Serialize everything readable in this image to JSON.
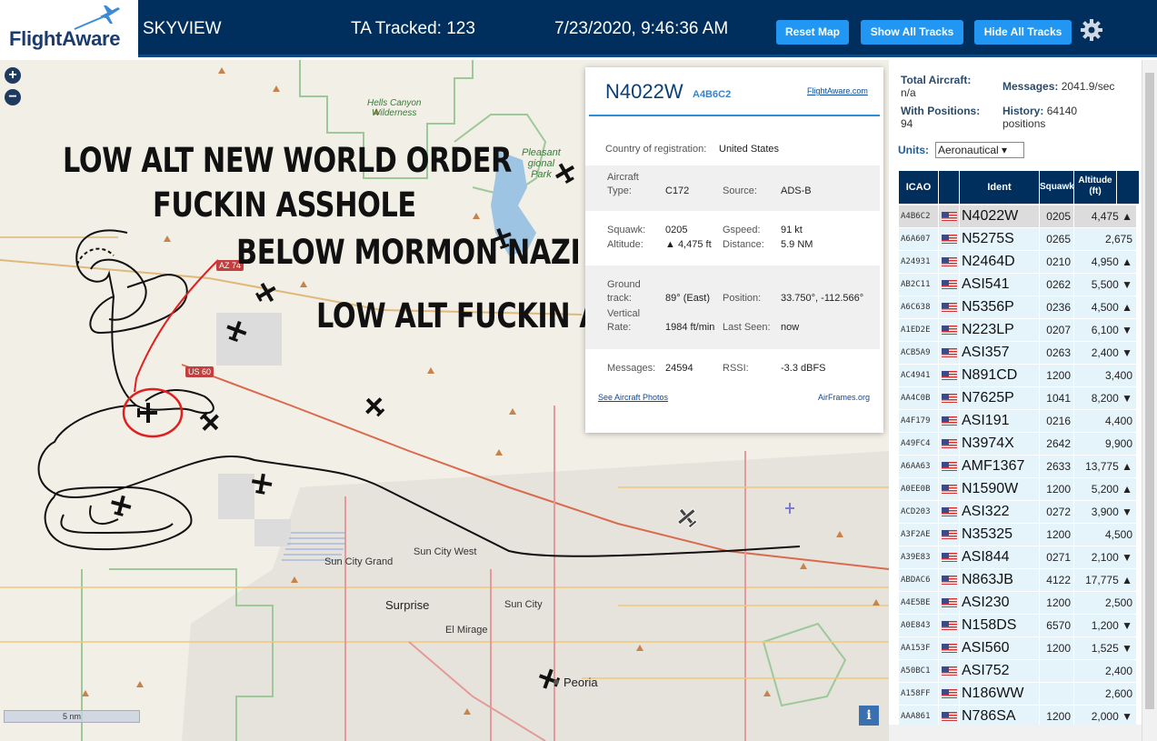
{
  "header": {
    "logo_text": "FlightAware",
    "app_name": "SKYVIEW",
    "tracked": "TA Tracked: 123",
    "clock": "7/23/2020, 9:46:36 AM",
    "buttons": {
      "reset": "Reset Map",
      "show": "Show All Tracks",
      "hide": "Hide All Tracks"
    }
  },
  "map": {
    "zoom_in": "+",
    "zoom_out": "−",
    "scale": "5 nm",
    "info": "i",
    "labels": {
      "hells_canyon": "Hells Canyon\nWilderness",
      "lake_pleasant": "Pleasant\ngional\nPark",
      "sun_city_grand": "Sun City Grand",
      "sun_city_west": "Sun City West",
      "surprise": "Surprise",
      "sun_city": "Sun City",
      "el_mirage": "El Mirage",
      "peoria": "Peoria"
    },
    "roads": [
      "AZ 74",
      "US 60"
    ],
    "overlay_text": [
      "LOW ALT NEW WORLD ORDER",
      "FUCKIN ASSHOLE",
      "BELOW MORMON NAZI VFR",
      "LOW ALT FUCKIN ASSHOLE"
    ]
  },
  "popup": {
    "ident": "N4022W",
    "hex": "A4B6C2",
    "fa_link": "FlightAware.com",
    "country_label": "Country of registration:",
    "country": "United States",
    "aircraft_type_label": "Aircraft\nType:",
    "aircraft_type": "C172",
    "source_label": "Source:",
    "source": "ADS-B",
    "squawk_label": "Squawk:",
    "squawk": "0205",
    "altitude_label": "Altitude:",
    "altitude": "▲ 4,475 ft",
    "gspeed_label": "Gspeed:",
    "gspeed": "91 kt",
    "distance_label": "Distance:",
    "distance": "5.9 NM",
    "track_label": "Ground\ntrack:",
    "track": "89° (East)",
    "position_label": "Position:",
    "position": "33.750°, -112.566°",
    "rate_label": "Vertical\nRate:",
    "rate": "1984 ft/min",
    "lastseen_label": "Last Seen:",
    "lastseen": "now",
    "messages_label": "Messages:",
    "messages": "24594",
    "rssi_label": "RSSI:",
    "rssi": "-3.3 dBFS",
    "photos_link": "See Aircraft Photos",
    "airframes_link": "AirFrames.org"
  },
  "panel": {
    "total_label": "Total Aircraft:",
    "total": "n/a",
    "messages_label": "Messages:",
    "messages": "2041.9/sec",
    "positions_label": "With Positions:",
    "positions": "94",
    "history_label": "History:",
    "history": "64140 positions",
    "units_label": "Units:",
    "units_value": "Aeronautical ▾",
    "columns": {
      "icao": "ICAO",
      "ident": "Ident",
      "squawk": "Squawk",
      "altitude": "Altitude\n(ft)"
    },
    "rows": [
      {
        "icao": "A4B6C2",
        "ident": "N4022W",
        "squawk": "0205",
        "alt": "4,475 ▲"
      },
      {
        "icao": "A6A607",
        "ident": "N5275S",
        "squawk": "0265",
        "alt": "2,675"
      },
      {
        "icao": "A24931",
        "ident": "N2464D",
        "squawk": "0210",
        "alt": "4,950 ▲"
      },
      {
        "icao": "AB2C11",
        "ident": "ASI541",
        "squawk": "0262",
        "alt": "5,500 ▼"
      },
      {
        "icao": "A6C638",
        "ident": "N5356P",
        "squawk": "0236",
        "alt": "4,500 ▲"
      },
      {
        "icao": "A1ED2E",
        "ident": "N223LP",
        "squawk": "0207",
        "alt": "6,100 ▼"
      },
      {
        "icao": "ACB5A9",
        "ident": "ASI357",
        "squawk": "0263",
        "alt": "2,400 ▼"
      },
      {
        "icao": "AC4941",
        "ident": "N891CD",
        "squawk": "1200",
        "alt": "3,400"
      },
      {
        "icao": "AA4C0B",
        "ident": "N7625P",
        "squawk": "1041",
        "alt": "8,200 ▼"
      },
      {
        "icao": "A4F179",
        "ident": "ASI191",
        "squawk": "0216",
        "alt": "4,400"
      },
      {
        "icao": "A49FC4",
        "ident": "N3974X",
        "squawk": "2642",
        "alt": "9,900"
      },
      {
        "icao": "A6AA63",
        "ident": "AMF1367",
        "squawk": "2633",
        "alt": "13,775 ▲"
      },
      {
        "icao": "A0EE0B",
        "ident": "N1590W",
        "squawk": "1200",
        "alt": "5,200 ▲"
      },
      {
        "icao": "ACD203",
        "ident": "ASI322",
        "squawk": "0272",
        "alt": "3,900 ▼"
      },
      {
        "icao": "A3F2AE",
        "ident": "N35325",
        "squawk": "1200",
        "alt": "4,500"
      },
      {
        "icao": "A39E83",
        "ident": "ASI844",
        "squawk": "0271",
        "alt": "2,100 ▼"
      },
      {
        "icao": "ABDAC6",
        "ident": "N863JB",
        "squawk": "4122",
        "alt": "17,775 ▲"
      },
      {
        "icao": "A4E5BE",
        "ident": "ASI230",
        "squawk": "1200",
        "alt": "2,500"
      },
      {
        "icao": "A0E843",
        "ident": "N158DS",
        "squawk": "6570",
        "alt": "1,200 ▼"
      },
      {
        "icao": "AA153F",
        "ident": "ASI560",
        "squawk": "1200",
        "alt": "1,525 ▼"
      },
      {
        "icao": "A50BC1",
        "ident": "ASI752",
        "squawk": "",
        "alt": "2,400"
      },
      {
        "icao": "A158FF",
        "ident": "N186WW",
        "squawk": "",
        "alt": "2,600"
      },
      {
        "icao": "AAA861",
        "ident": "N786SA",
        "squawk": "1200",
        "alt": "2,000 ▼"
      }
    ]
  },
  "colors": {
    "header_bg": "#002f5d",
    "button_blue": "#2196f3",
    "table_header": "#002f5d",
    "row_bg": "#e5f3fb",
    "selected_row": "#dcdcdc",
    "track_line": "#111111",
    "selected_track": "#e02020"
  }
}
